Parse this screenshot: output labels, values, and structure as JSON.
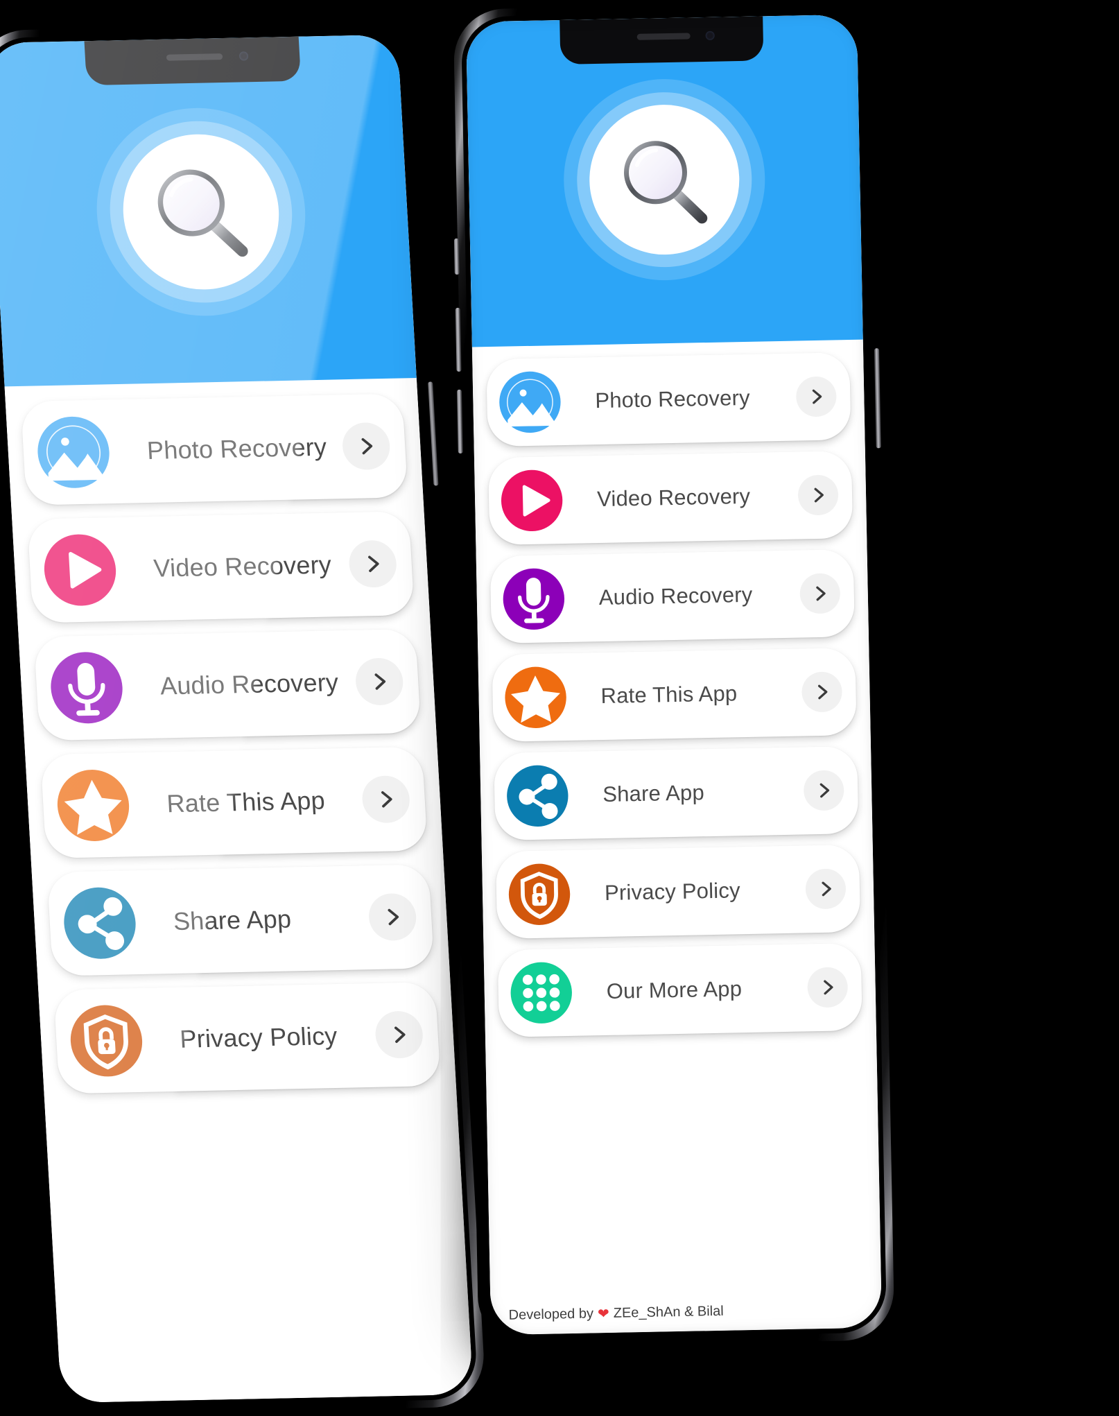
{
  "app": {
    "logo_icon": "magnifier-icon",
    "header_color": "#2ca5f7",
    "background_color": "#000000"
  },
  "phones": [
    {
      "id": "left",
      "name": "left-phone",
      "footer_visible": false,
      "menu": [
        {
          "label": "Photo Recovery",
          "icon": "photo-icon",
          "color": "#3fa9f5",
          "chevron": "chevron-right-icon"
        },
        {
          "label": "Video Recovery",
          "icon": "video-icon",
          "color": "#ec1164",
          "chevron": "chevron-right-icon"
        },
        {
          "label": "Audio Recovery",
          "icon": "mic-icon",
          "color": "#8c00b8",
          "chevron": "chevron-right-icon"
        },
        {
          "label": "Rate This App",
          "icon": "star-icon",
          "color": "#ef6c10",
          "chevron": "chevron-right-icon"
        },
        {
          "label": "Share App",
          "icon": "share-icon",
          "color": "#0b7db0",
          "chevron": "chevron-right-icon"
        },
        {
          "label": "Privacy Policy",
          "icon": "shield-lock-icon",
          "color": "#d2570c",
          "chevron": "chevron-right-icon"
        }
      ]
    },
    {
      "id": "right",
      "name": "right-phone",
      "footer_visible": true,
      "footer": {
        "prefix": "Developed by",
        "heart": "❤",
        "authors": "ZEe_ShAn & Bilal"
      },
      "menu": [
        {
          "label": "Photo Recovery",
          "icon": "photo-icon",
          "color": "#3fa9f5",
          "chevron": "chevron-right-icon"
        },
        {
          "label": "Video Recovery",
          "icon": "video-icon",
          "color": "#ec1164",
          "chevron": "chevron-right-icon"
        },
        {
          "label": "Audio Recovery",
          "icon": "mic-icon",
          "color": "#8c00b8",
          "chevron": "chevron-right-icon"
        },
        {
          "label": "Rate This App",
          "icon": "star-icon",
          "color": "#ef6c10",
          "chevron": "chevron-right-icon"
        },
        {
          "label": "Share App",
          "icon": "share-icon",
          "color": "#0b7db0",
          "chevron": "chevron-right-icon"
        },
        {
          "label": "Privacy Policy",
          "icon": "shield-lock-icon",
          "color": "#d2570c",
          "chevron": "chevron-right-icon"
        },
        {
          "label": "Our More App",
          "icon": "grid-apps-icon",
          "color": "#12cf96",
          "chevron": "chevron-right-icon"
        }
      ]
    }
  ]
}
